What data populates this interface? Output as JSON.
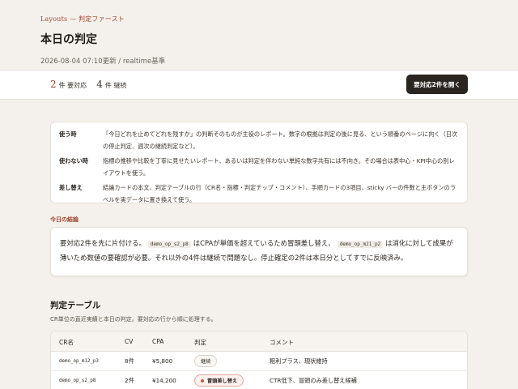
{
  "header": {
    "eyebrow": "Layouts — 判定ファースト",
    "title": "本日の判定",
    "updated": "2026-08-04 07:10更新 / realtime基準"
  },
  "sticky_bar": {
    "action_count": "2",
    "action_label": "件 要対応",
    "continue_count": "4",
    "continue_label": "件 継続",
    "primary_button": "要対応2件を開く"
  },
  "usage": [
    {
      "key": "使う時",
      "value": "「今日どれを止めてどれを残すか」の判断そのものが主役のレポート。数字の根拠は判定の後に見る、という順番のページに向く（日次の停止判定、週次の継続判定など）。"
    },
    {
      "key": "使わない時",
      "value": "指標の推移や比較を丁寧に見せたいレポート、あるいは判定を伴わない単純な数字共有には不向き。その場合は表中心・KPI中心の別レイアウトを使う。"
    },
    {
      "key": "差し替え",
      "value": "結論カードの本文、判定テーブルの行（CR名・指標・判定チップ・コメント）、手順カードの3項目、sticky バーの件数と主ボタンのラベルを実データに置き換えて使う。"
    }
  ],
  "conclusion": {
    "label": "今日の結論",
    "part1": "要対応2件を先に片付ける。",
    "code1": "demo_op_s2_p8",
    "part2": "はCPAが単価を超えているため冒頭差し替え、",
    "code2": "demo_op_m21_p2",
    "part3": "は消化に対して成果が薄いため数値の要確認が必要。それ以外の4件は継続で問題なし。停止確定の2件は本日分としてすでに反映済み。"
  },
  "table": {
    "title": "判定テーブル",
    "subtitle": "CR単位の直近実績と本日の判定。要対応の行から順に処理する。",
    "headers": [
      "CR名",
      "CV",
      "CPA",
      "判定",
      "コメント"
    ],
    "rows": [
      {
        "name": "demo_op_m12_p3",
        "cv": "8件",
        "cpa": "¥5,800",
        "verdict": "継続",
        "comment": "粗利プラス、現状維持"
      },
      {
        "name": "demo_op_s2_p8",
        "cv": "2件",
        "cpa": "¥14,200",
        "verdict": "冒頭差し替え",
        "comment": "CTR低下、冒頭のみ差し替え候補"
      }
    ]
  },
  "colors": {
    "accent": "#a0452e",
    "danger_dot": "#d2543c",
    "primary_button": "#2a2520",
    "background": "#f4f1ec"
  }
}
